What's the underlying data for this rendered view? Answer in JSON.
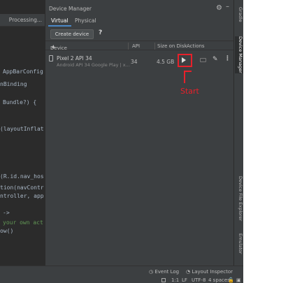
{
  "editor": {
    "status_text": "Processing...",
    "code_lines": [
      {
        "text": "AppBarConfig",
        "kind": "code"
      },
      {
        "text": "nBinding",
        "kind": "code"
      },
      {
        "text": "Bundle?) {",
        "kind": "code"
      },
      {
        "text": "(layoutInflat",
        "kind": "code"
      },
      {
        "text": "(R.id.nav_hos",
        "kind": "code"
      },
      {
        "text": "tion(navContr",
        "kind": "code"
      },
      {
        "text": "ntroller, app",
        "kind": "code"
      },
      {
        "text": "->",
        "kind": "code"
      },
      {
        "text": "your own act",
        "kind": "comment"
      },
      {
        "text": "ow()",
        "kind": "code"
      }
    ]
  },
  "device_manager": {
    "title": "Device Manager",
    "settings_icon": "gear-icon",
    "minimize_icon": "minimize-icon",
    "tabs": [
      {
        "label": "Virtual",
        "active": true
      },
      {
        "label": "Physical",
        "active": false
      }
    ],
    "create_button": "Create device",
    "help_icon": "?",
    "columns": {
      "device": "Device",
      "sort_indicator": "▲",
      "api": "API",
      "size": "Size on Disk",
      "actions": "Actions"
    },
    "devices": [
      {
        "name": "Pixel 2 API 34",
        "subtitle": "Android API 34 Google Play | x...",
        "api": "34",
        "size": "4.5 GB"
      }
    ]
  },
  "annotation": {
    "label": "Start",
    "color": "#e8202a"
  },
  "side_tabs": {
    "gradle": "Gradle",
    "device_manager": "Device Manager",
    "device_file_explorer": "Device File Explorer",
    "emulator": "Emulator"
  },
  "status_bar": {
    "event_log": "Event Log",
    "layout_inspector": "Layout Inspector",
    "position": "1:1",
    "line_sep": "LF",
    "encoding": "UTF-8",
    "indent": "4 spaces"
  },
  "colors": {
    "panel_bg": "#3c3f41",
    "editor_bg": "#2b2b2b",
    "accent_tab": "#4a88c7",
    "highlight": "#e8202a"
  }
}
